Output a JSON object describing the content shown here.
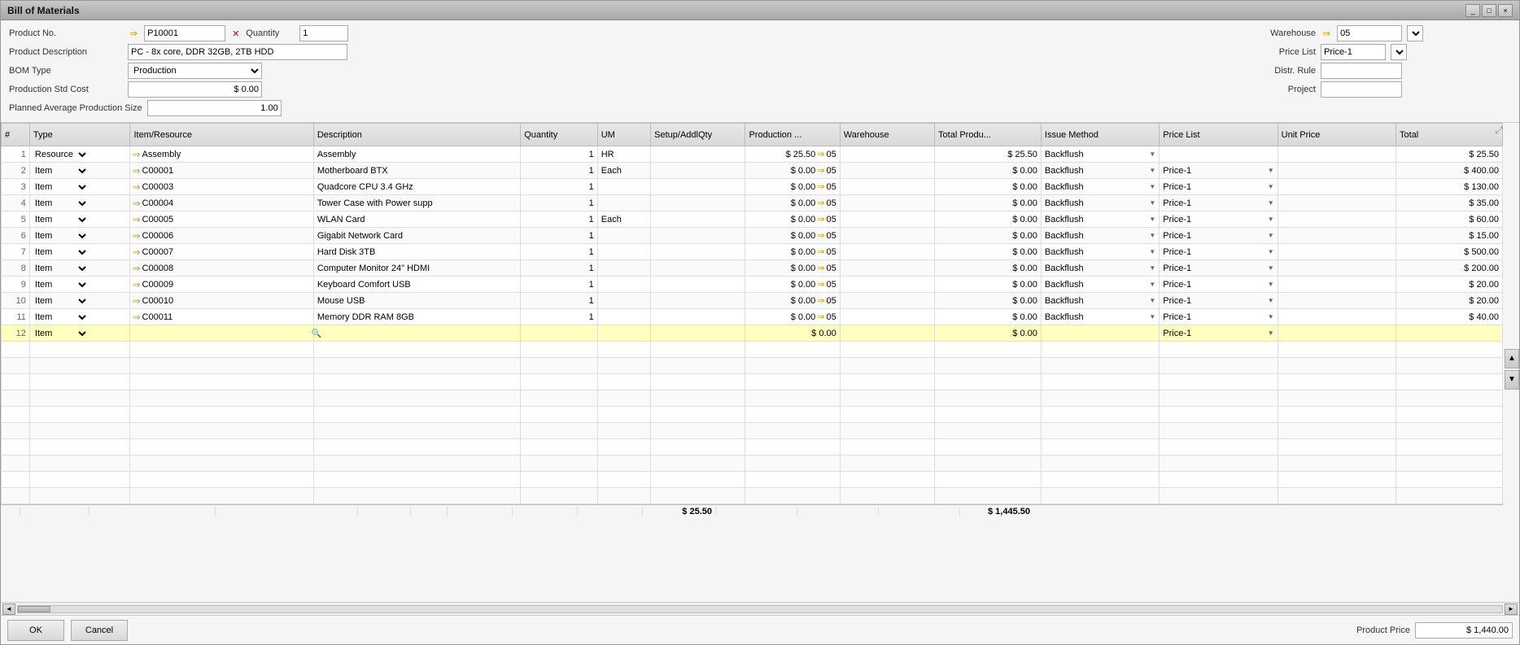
{
  "window": {
    "title": "Bill of Materials",
    "buttons": [
      "_",
      "□",
      "×"
    ]
  },
  "form": {
    "product_no_label": "Product No.",
    "product_no_value": "P10001",
    "quantity_label": "Quantity",
    "quantity_value": "1",
    "product_desc_label": "Product Description",
    "product_desc_value": "PC - 8x core, DDR 32GB, 2TB HDD",
    "bom_type_label": "BOM Type",
    "bom_type_value": "Production",
    "prod_std_cost_label": "Production Std Cost",
    "prod_std_cost_value": "$ 0.00",
    "planned_avg_label": "Planned Average Production Size",
    "planned_avg_value": "1.00"
  },
  "right_form": {
    "warehouse_label": "Warehouse",
    "warehouse_value": "05",
    "price_list_label": "Price List",
    "price_list_value": "Price-1",
    "distr_rule_label": "Distr. Rule",
    "distr_rule_value": "",
    "project_label": "Project",
    "project_value": ""
  },
  "table": {
    "headers": [
      "#",
      "Type",
      "Item/Resource",
      "Description",
      "Quantity",
      "UM",
      "Setup/AddlQty",
      "Production ...",
      "Warehouse",
      "Total Produ...",
      "Issue Method",
      "Price List",
      "Unit Price",
      "Total"
    ],
    "rows": [
      {
        "num": "1",
        "type": "Resource",
        "item": "Assembly",
        "desc": "Assembly",
        "qty": "1",
        "um": "HR",
        "setup": "",
        "prod": "$ 25.50",
        "wh": "05",
        "totalprod": "$ 25.50",
        "issue": "Backflush",
        "pricelist": "",
        "unitprice": "",
        "total": "$ 25.50"
      },
      {
        "num": "2",
        "type": "Item",
        "item": "C00001",
        "desc": "Motherboard BTX",
        "qty": "1",
        "um": "Each",
        "setup": "",
        "prod": "$ 0.00",
        "wh": "05",
        "totalprod": "$ 0.00",
        "issue": "Backflush",
        "pricelist": "Price-1",
        "unitprice": "",
        "total": "$ 400.00"
      },
      {
        "num": "3",
        "type": "Item",
        "item": "C00003",
        "desc": "Quadcore CPU 3.4 GHz",
        "qty": "1",
        "um": "",
        "setup": "",
        "prod": "$ 0.00",
        "wh": "05",
        "totalprod": "$ 0.00",
        "issue": "Backflush",
        "pricelist": "Price-1",
        "unitprice": "",
        "total": "$ 130.00"
      },
      {
        "num": "4",
        "type": "Item",
        "item": "C00004",
        "desc": "Tower Case with Power supp",
        "qty": "1",
        "um": "",
        "setup": "",
        "prod": "$ 0.00",
        "wh": "05",
        "totalprod": "$ 0.00",
        "issue": "Backflush",
        "pricelist": "Price-1",
        "unitprice": "",
        "total": "$ 35.00"
      },
      {
        "num": "5",
        "type": "Item",
        "item": "C00005",
        "desc": "WLAN Card",
        "qty": "1",
        "um": "Each",
        "setup": "",
        "prod": "$ 0.00",
        "wh": "05",
        "totalprod": "$ 0.00",
        "issue": "Backflush",
        "pricelist": "Price-1",
        "unitprice": "",
        "total": "$ 60.00"
      },
      {
        "num": "6",
        "type": "Item",
        "item": "C00006",
        "desc": "Gigabit Network Card",
        "qty": "1",
        "um": "",
        "setup": "",
        "prod": "$ 0.00",
        "wh": "05",
        "totalprod": "$ 0.00",
        "issue": "Backflush",
        "pricelist": "Price-1",
        "unitprice": "",
        "total": "$ 15.00"
      },
      {
        "num": "7",
        "type": "Item",
        "item": "C00007",
        "desc": "Hard Disk 3TB",
        "qty": "1",
        "um": "",
        "setup": "",
        "prod": "$ 0.00",
        "wh": "05",
        "totalprod": "$ 0.00",
        "issue": "Backflush",
        "pricelist": "Price-1",
        "unitprice": "",
        "total": "$ 500.00"
      },
      {
        "num": "8",
        "type": "Item",
        "item": "C00008",
        "desc": "Computer Monitor 24\" HDMI",
        "qty": "1",
        "um": "",
        "setup": "",
        "prod": "$ 0.00",
        "wh": "05",
        "totalprod": "$ 0.00",
        "issue": "Backflush",
        "pricelist": "Price-1",
        "unitprice": "",
        "total": "$ 200.00"
      },
      {
        "num": "9",
        "type": "Item",
        "item": "C00009",
        "desc": "Keyboard Comfort USB",
        "qty": "1",
        "um": "",
        "setup": "",
        "prod": "$ 0.00",
        "wh": "05",
        "totalprod": "$ 0.00",
        "issue": "Backflush",
        "pricelist": "Price-1",
        "unitprice": "",
        "total": "$ 20.00"
      },
      {
        "num": "10",
        "type": "Item",
        "item": "C00010",
        "desc": "Mouse USB",
        "qty": "1",
        "um": "",
        "setup": "",
        "prod": "$ 0.00",
        "wh": "05",
        "totalprod": "$ 0.00",
        "issue": "Backflush",
        "pricelist": "Price-1",
        "unitprice": "",
        "total": "$ 20.00"
      },
      {
        "num": "11",
        "type": "Item",
        "item": "C00011",
        "desc": "Memory DDR RAM 8GB",
        "qty": "1",
        "um": "",
        "setup": "",
        "prod": "$ 0.00",
        "wh": "05",
        "totalprod": "$ 0.00",
        "issue": "Backflush",
        "pricelist": "Price-1",
        "unitprice": "",
        "total": "$ 40.00"
      },
      {
        "num": "12",
        "type": "Item",
        "item": "",
        "desc": "",
        "qty": "",
        "um": "",
        "setup": "",
        "prod": "$ 0.00",
        "wh": "",
        "totalprod": "$ 0.00",
        "issue": "",
        "pricelist": "Price-1",
        "unitprice": "",
        "total": "",
        "is_new": true
      }
    ],
    "footer_totalprod": "$ 25.50",
    "footer_total": "$ 1,445.50"
  },
  "bottom": {
    "ok_label": "OK",
    "cancel_label": "Cancel",
    "product_price_label": "Product Price",
    "product_price_value": "$ 1,440.00"
  }
}
